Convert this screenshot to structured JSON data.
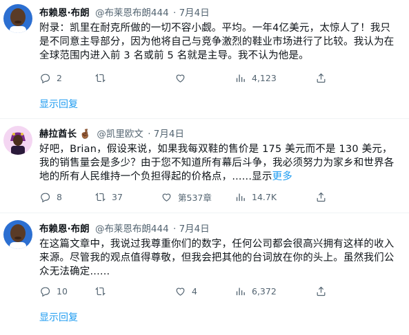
{
  "tweets": [
    {
      "name": "布赖恩·布朗",
      "handle": "@布莱恩布朗444",
      "date": "· 7月4日",
      "text": "附录：凯里在耐克所做的一切不容小觑。平均。一年4亿美元，太惊人了！我只是不同意主导部分，因为他将自己与竞争激烈的鞋业市场进行了比较。我认为在全球范围内进入前 3 名或前 5 名就是主导。我不认为他是。",
      "replies": "2",
      "retweets": "",
      "likes": "",
      "views": "4,123",
      "show_replies": "显示回复"
    },
    {
      "name": "赫拉酋长",
      "name_emoji": "🤞🏾",
      "handle": "@凯里欧文",
      "date": "· 7月4日",
      "text": "好吧，Brian，假设来说，如果我每双鞋的售价是 175 美元而不是 130 美元，我的销售量会是多少？由于您不知道所有幕后斗争，我必须努力为家乡和世界各地的所有人民维持一个负担得起的价格点，",
      "text_tail": "......显示",
      "more_label": "更多",
      "replies": "8",
      "retweets": "37",
      "likes": "第537章",
      "views": "14.7K"
    },
    {
      "name": "布赖恩·布朗",
      "handle": "@布莱恩布朗444",
      "date": "· 7月4日",
      "text": "在这篇文章中，我说过我尊重你们的数字，任何公司都会很高兴拥有这样的收入来源。尽管我的观点值得尊敬，但我会把其他的台词放在你的头上。虽然我们公众无法确定......",
      "replies": "10",
      "retweets": "",
      "likes": "4",
      "views": "6,372",
      "show_replies": "显示回复"
    }
  ],
  "colors": {
    "link": "#1d9bf0",
    "muted": "#536471",
    "divider": "#eff3f4"
  }
}
